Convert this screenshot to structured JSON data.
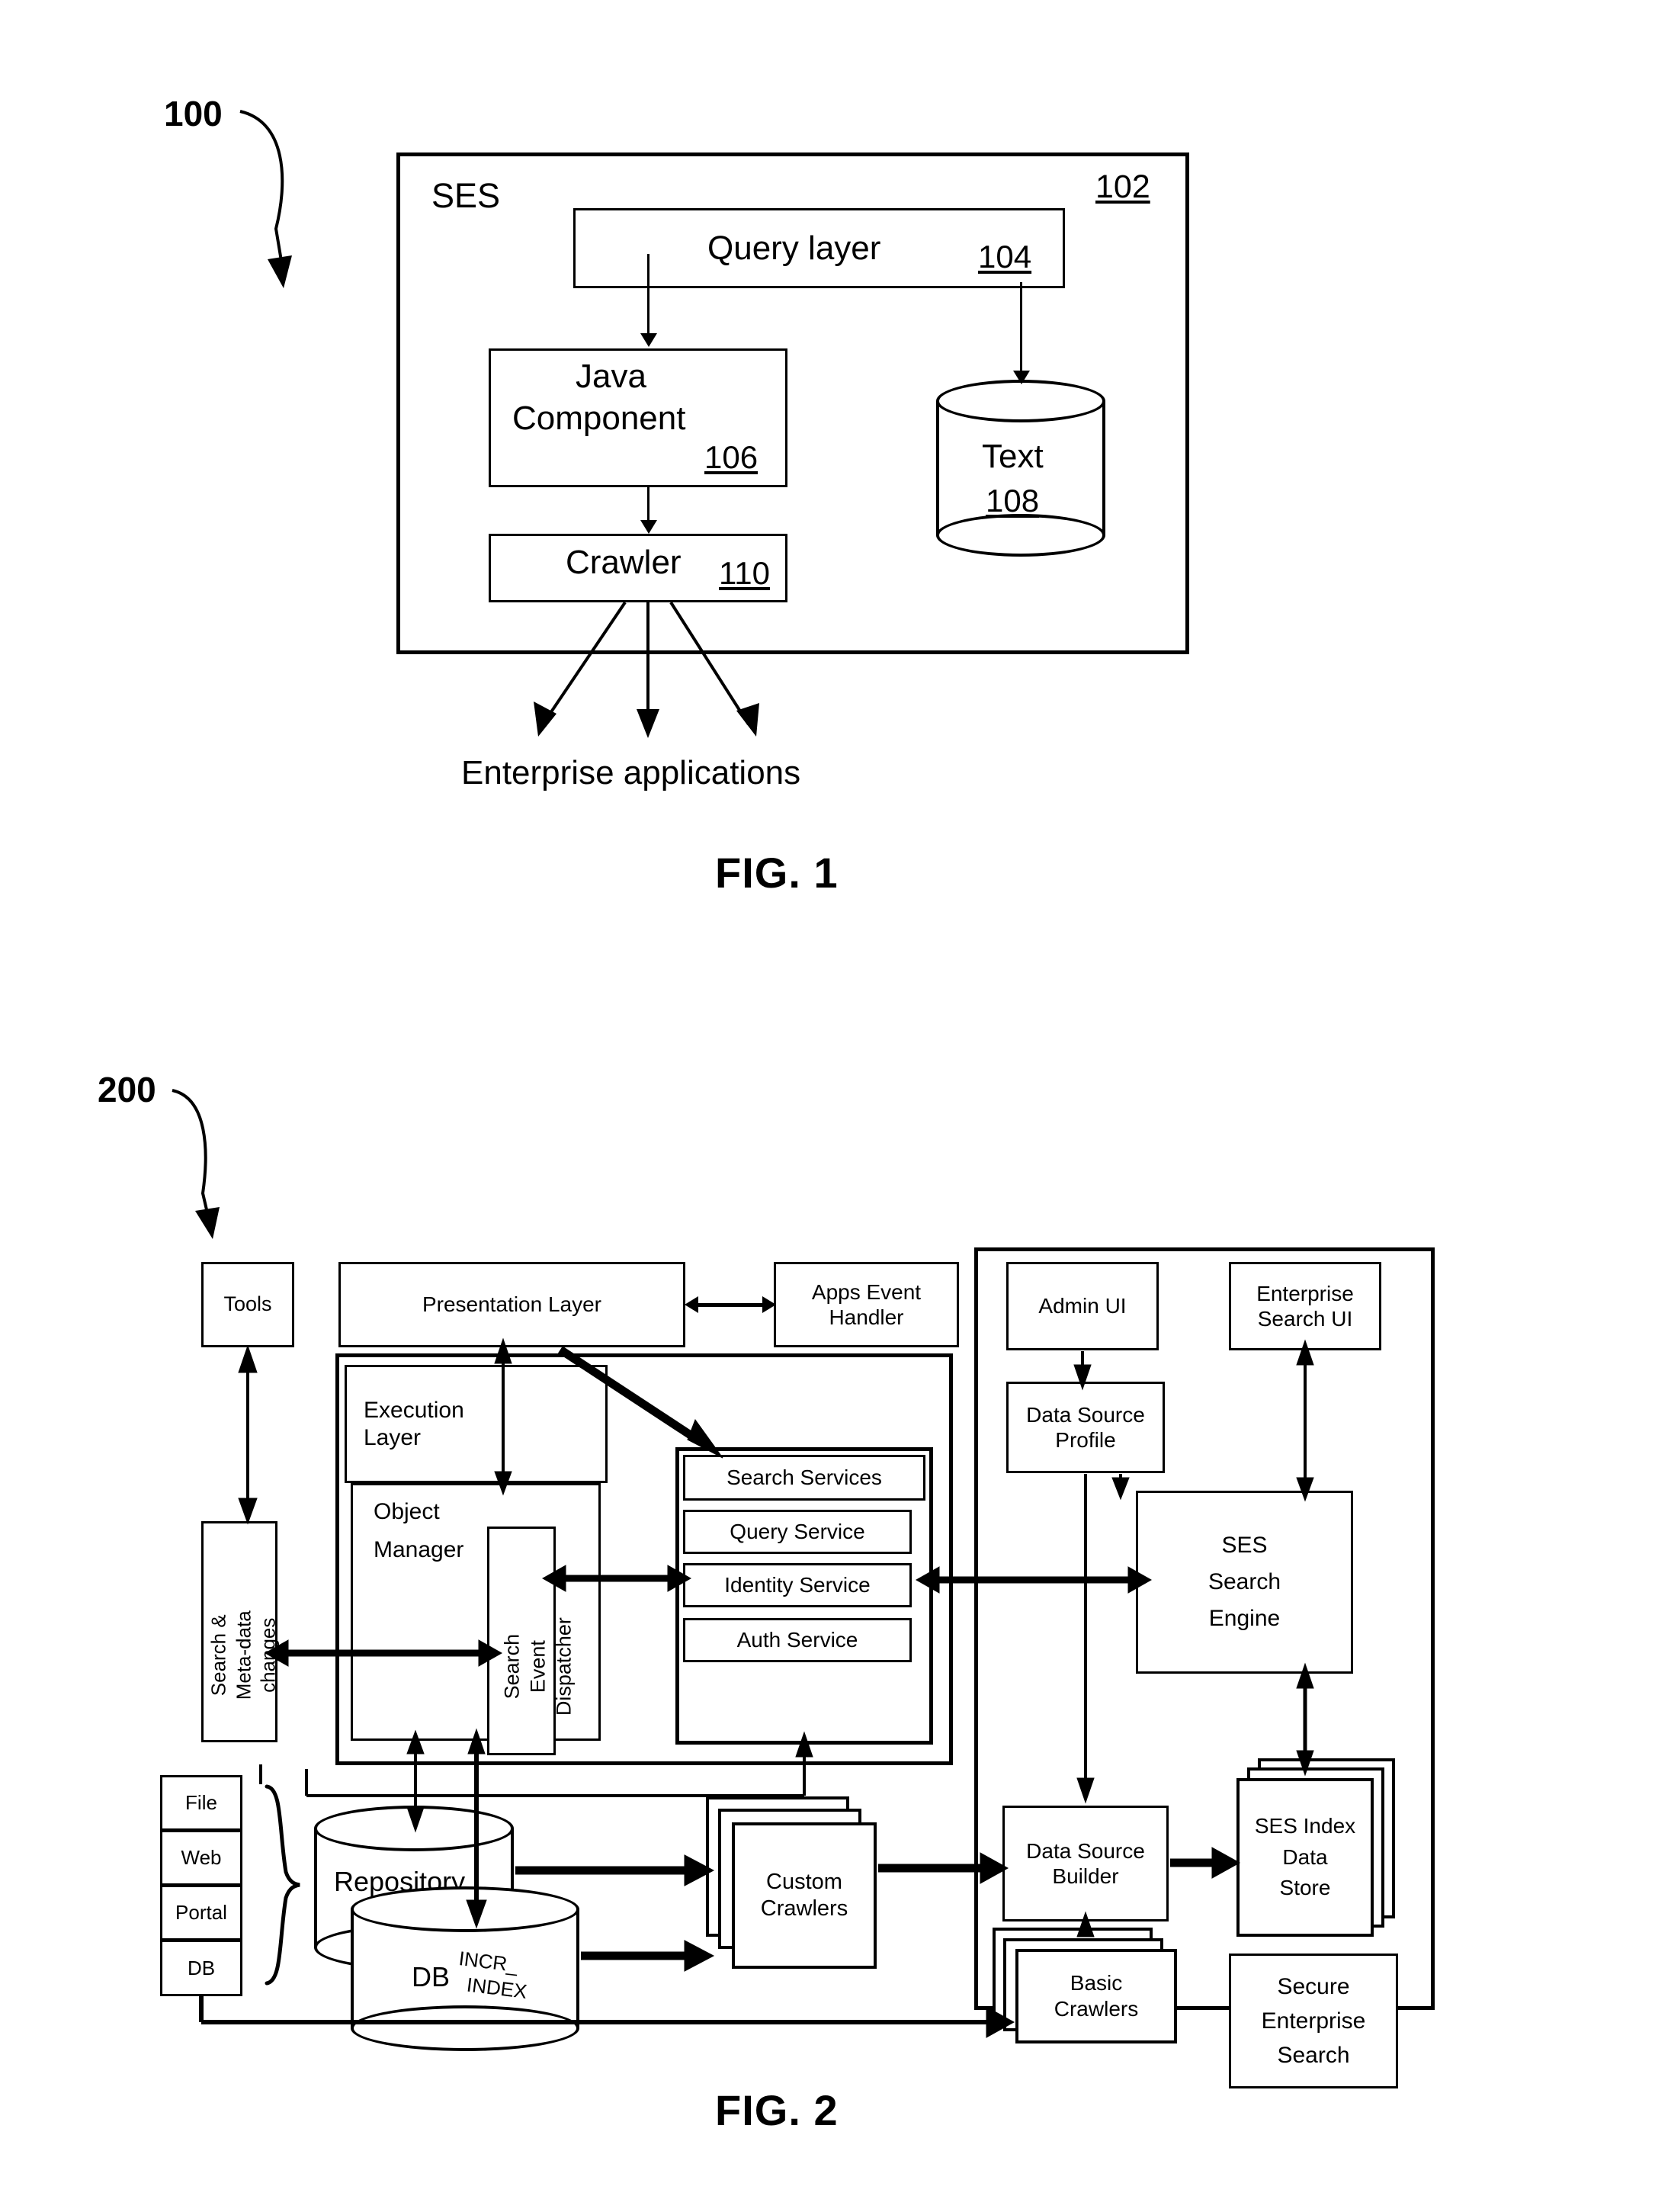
{
  "document": {
    "type": "patent-figure-sheet",
    "figures": [
      "FIG. 1",
      "FIG. 2"
    ]
  },
  "fig1": {
    "caption": "FIG. 1",
    "ref_numeral": "100",
    "outer": {
      "label": "SES",
      "ref": "102"
    },
    "blocks": [
      {
        "id": "query_layer",
        "label": "Query layer",
        "ref": "104"
      },
      {
        "id": "java_component",
        "label": "Java\nComponent",
        "ref": "106"
      },
      {
        "id": "crawler",
        "label": "Crawler",
        "ref": "110"
      }
    ],
    "datastore": {
      "id": "text_store",
      "label": "Text",
      "ref": "108"
    },
    "bottom_label": "Enterprise applications"
  },
  "fig2": {
    "caption": "FIG. 2",
    "ref_numeral": "200",
    "blocks": {
      "tools": "Tools",
      "presentation_layer": "Presentation Layer",
      "apps_event_handler": "Apps Event\nHandler",
      "admin_ui": "Admin UI",
      "enterprise_search_ui": "Enterprise\nSearch UI",
      "execution_layer": "Execution\nLayer",
      "object_manager": "Object\nManager",
      "search_event_dispatcher": "Search\nEvent\nDispatcher",
      "search_meta_data_changes": "Search &\nMeta-data\nchanges",
      "data_source_profile": "Data Source\nProfile",
      "ses_search_engine": "SES\nSearch\nEngine",
      "custom_crawlers": "Custom\nCrawlers",
      "basic_crawlers": "Basic\nCrawlers",
      "data_source_builder": "Data Source\nBuilder",
      "ses_index_data_store": "SES Index\nData\nStore",
      "secure_enterprise_search": "Secure\nEnterprise\nSearch",
      "repository": "Repository",
      "db": "DB",
      "incr_index": "INCR_\nINDEX"
    },
    "search_services": {
      "title": "Search Services",
      "items": [
        "Query Service",
        "Identity Service",
        "Auth Service"
      ]
    },
    "sources": [
      "File",
      "Web",
      "Portal",
      "DB"
    ]
  },
  "colors": {
    "ink": "#000000",
    "paper": "#ffffff"
  }
}
